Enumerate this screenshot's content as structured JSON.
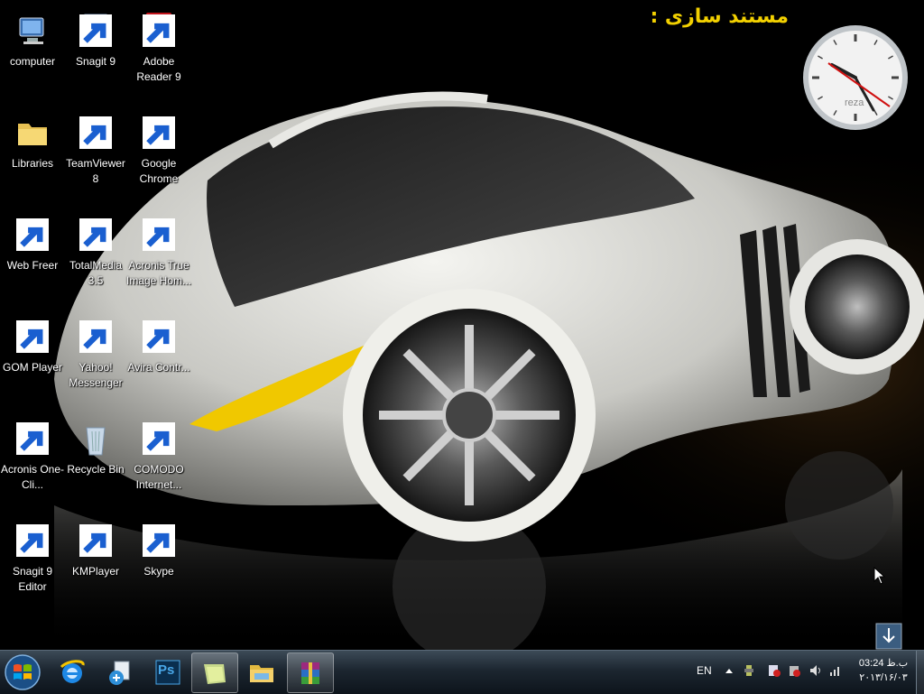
{
  "desktop": {
    "title": "مستند سازی :",
    "icons": [
      {
        "label": "computer",
        "icon": "computer-icon"
      },
      {
        "label": "Snagit 9",
        "icon": "snagit-icon"
      },
      {
        "label": "Adobe Reader 9",
        "icon": "adobe-reader-icon"
      },
      {
        "label": "Libraries",
        "icon": "libraries-icon"
      },
      {
        "label": "TeamViewer 8",
        "icon": "teamviewer-icon"
      },
      {
        "label": "Google Chrome",
        "icon": "chrome-icon"
      },
      {
        "label": "Web Freer",
        "icon": "web-freer-icon"
      },
      {
        "label": "TotalMedia 3.5",
        "icon": "totalmedia-icon"
      },
      {
        "label": "Acronis True Image Hom...",
        "icon": "acronis-true-image-icon"
      },
      {
        "label": "GOM Player",
        "icon": "gom-player-icon"
      },
      {
        "label": "Yahoo! Messenger",
        "icon": "yahoo-messenger-icon"
      },
      {
        "label": "Avira Contr...",
        "icon": "avira-icon"
      },
      {
        "label": "Acronis One-Cli...",
        "icon": "acronis-oneclick-icon"
      },
      {
        "label": "Recycle Bin",
        "icon": "recycle-bin-icon"
      },
      {
        "label": "COMODO Internet...",
        "icon": "comodo-icon"
      },
      {
        "label": "Snagit 9 Editor",
        "icon": "snagit-editor-icon"
      },
      {
        "label": "KMPlayer",
        "icon": "kmplayer-icon"
      },
      {
        "label": "Skype",
        "icon": "skype-icon"
      }
    ],
    "clock_gadget": {
      "brand": "reza"
    }
  },
  "taskbar": {
    "pinned": [
      {
        "name": "internet-explorer-icon"
      },
      {
        "name": "network-connection-icon"
      },
      {
        "name": "photoshop-icon",
        "text": "Ps"
      },
      {
        "name": "sticky-notes-icon"
      },
      {
        "name": "windows-explorer-icon"
      },
      {
        "name": "winrar-icon"
      }
    ],
    "tray": {
      "language": "EN",
      "time": "03:24 ب.ظ",
      "date": "۲۰۱۳/۱۶/۰۳"
    }
  },
  "colors": {
    "title": "#f2d000",
    "taskbar": "#1c2630"
  }
}
